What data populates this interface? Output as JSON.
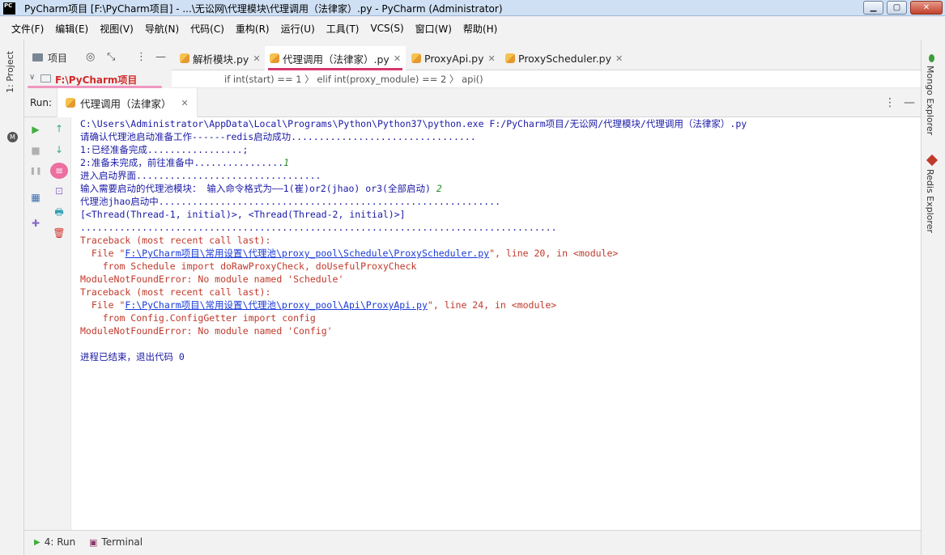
{
  "window": {
    "title": "PyCharm项目 [F:\\PyCharm项目] - ...\\无讼网\\代理模块\\代理调用（法律家）.py - PyCharm (Administrator)",
    "app_icon_text": [
      "PC",
      "■"
    ],
    "min_glyph": "▁",
    "max_glyph": "▢",
    "close_glyph": "✕"
  },
  "menu": [
    "文件(F)",
    "编辑(E)",
    "视图(V)",
    "导航(N)",
    "代码(C)",
    "重构(R)",
    "运行(U)",
    "工具(T)",
    "VCS(S)",
    "窗口(W)",
    "帮助(H)"
  ],
  "left_strip": {
    "project_label": "1: Project",
    "m_icon": "M"
  },
  "right_strip": {
    "mongo": "Mongo Explorer",
    "redis": "Redis Explorer"
  },
  "project_panel": {
    "label": "项目",
    "tree_root": "F:\\PyCharm项目",
    "tool_locate": "◎",
    "tool_collapse": "⤡",
    "tool_more": "⋮",
    "tool_hide": "—",
    "chevron": "∨"
  },
  "editor_tabs": [
    {
      "label": "解析模块.py",
      "active": false
    },
    {
      "label": "代理调用（法律家）.py",
      "active": true
    },
    {
      "label": "ProxyApi.py",
      "active": false
    },
    {
      "label": "ProxyScheduler.py",
      "active": false
    }
  ],
  "tab_close": "✕",
  "breadcrumb": "if int(start) == 1  〉 elif int(proxy_module) == 2  〉 api()",
  "run": {
    "label": "Run:",
    "tab_label": "代理调用（法律家）",
    "tab_close": "✕",
    "opt_more": "⋮",
    "opt_hide": "—"
  },
  "run_toolbar_1": [
    "▶",
    "■",
    "❚❚",
    "▦",
    "✚"
  ],
  "run_toolbar_2": [
    "↑",
    "↓",
    "≡",
    "⊡",
    "🖶",
    "🗑"
  ],
  "console": {
    "cmd": "C:\\Users\\Administrator\\AppData\\Local\\Programs\\Python\\Python37\\python.exe F:/PyCharm项目/无讼网/代理模块/代理调用（法律家）.py",
    "l1": "请确认代理池启动准备工作------redis启动成功.................................",
    "l2": "1:已经准备完成.................;",
    "l3_text": "2:准备未完成，前往准备中................",
    "l3_input": "1",
    "l4": "进入启动界面.................................",
    "l5_text": "输入需要启动的代理池模块： 输入命令格式为——1(崔)or2(jhao) or3(全部启动) ",
    "l5_input": "2",
    "l6": "代理池jhao启动中.............................................................",
    "l7": "[<Thread(Thread-1, initial)>, <Thread(Thread-2, initial)>]",
    "l8": ".....................................................................................",
    "tb1_head": "Traceback (most recent call last):",
    "tb1_file_pre": "  File \"",
    "tb1_file_link": "F:\\PyCharm项目\\常用设置\\代理池\\proxy_pool\\Schedule\\ProxyScheduler.py",
    "tb1_file_post": "\", line 20, in <module>",
    "tb1_code": "    from Schedule import doRawProxyCheck, doUsefulProxyCheck",
    "tb1_err": "ModuleNotFoundError: No module named 'Schedule'",
    "tb2_head": "Traceback (most recent call last):",
    "tb2_file_pre": "  File \"",
    "tb2_file_link": "F:\\PyCharm项目\\常用设置\\代理池\\proxy_pool\\Api\\ProxyApi.py",
    "tb2_file_post": "\", line 24, in <module>",
    "tb2_code": "    from Config.ConfigGetter import config",
    "tb2_err": "ModuleNotFoundError: No module named 'Config'",
    "exit": "进程已结束，退出代码 0"
  },
  "bottom": {
    "run": "4: Run",
    "run_icon": "▶",
    "terminal": "Terminal",
    "terminal_icon": "▣"
  },
  "colors": {
    "accent_tab": "#d6376a",
    "error_text": "#c0392b",
    "stdout_text": "#1a1aa6",
    "link": "#1a3ad8",
    "user_input": "#2b8a2b"
  }
}
